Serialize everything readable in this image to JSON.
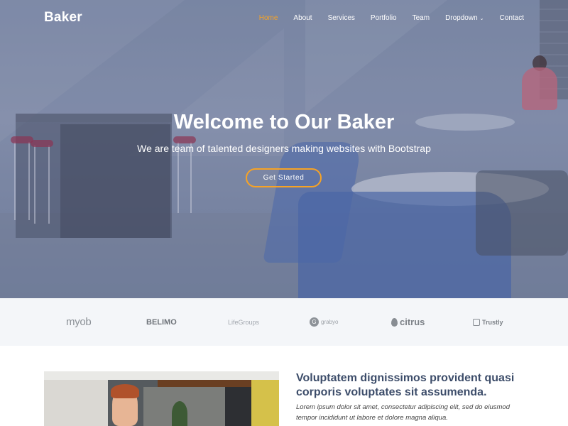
{
  "brand": {
    "logo_text": "Baker",
    "accent_color": "#f7a325"
  },
  "nav": {
    "items": [
      {
        "label": "Home",
        "active": true
      },
      {
        "label": "About"
      },
      {
        "label": "Services"
      },
      {
        "label": "Portfolio"
      },
      {
        "label": "Team"
      },
      {
        "label": "Dropdown",
        "has_caret": true
      },
      {
        "label": "Contact"
      }
    ]
  },
  "hero": {
    "title": "Welcome to Our Baker",
    "subtitle": "We are team of talented designers making websites with Bootstrap",
    "cta_label": "Get Started"
  },
  "clients": {
    "logos": [
      {
        "name": "myob",
        "text": "myob"
      },
      {
        "name": "belimo",
        "text": "BELIMO"
      },
      {
        "name": "lifegroups",
        "text": "LifeGroups"
      },
      {
        "name": "grabyo",
        "text": "grabyo",
        "mark": "G"
      },
      {
        "name": "citrus",
        "text": "citrus"
      },
      {
        "name": "trustly",
        "text": "Trustly"
      }
    ]
  },
  "about": {
    "title": "Voluptatem dignissimos provident quasi corporis voluptates sit assumenda.",
    "text": "Lorem ipsum dolor sit amet, consectetur adipiscing elit, sed do eiusmod tempor incididunt ut labore et dolore magna aliqua."
  }
}
